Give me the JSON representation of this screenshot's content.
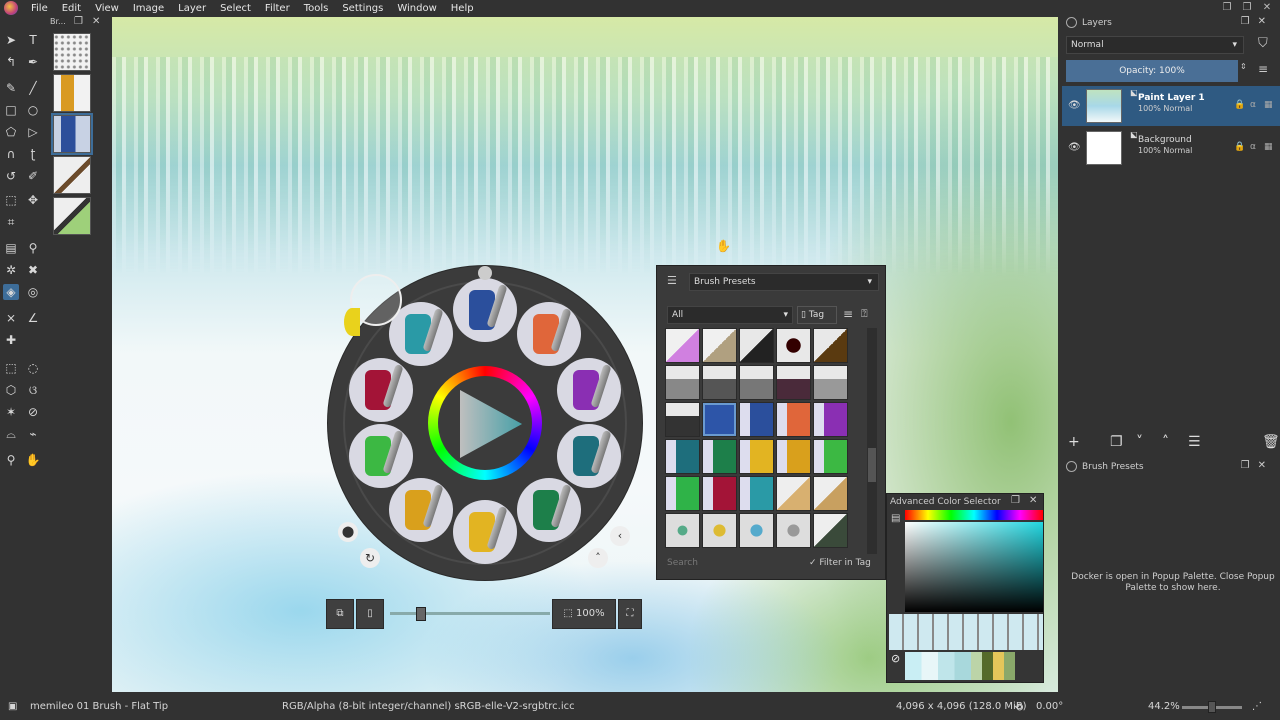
{
  "menu": {
    "items": [
      "File",
      "Edit",
      "View",
      "Image",
      "Layer",
      "Select",
      "Filter",
      "Tools",
      "Settings",
      "Window",
      "Help"
    ]
  },
  "brush_strip": {
    "title": "Br..."
  },
  "layers": {
    "title": "Layers",
    "blend_mode": "Normal",
    "opacity_label": "Opacity:  100%",
    "items": [
      {
        "name": "Paint Layer 1",
        "mode": "100% Normal"
      },
      {
        "name": "Background",
        "mode": "100% Normal"
      }
    ]
  },
  "brush_presets_docker": {
    "title": "Brush Presets",
    "message": "Docker is open in Popup Palette. Close Popup Palette to show here."
  },
  "brush_presets_popup": {
    "title": "Brush Presets",
    "filter": "All",
    "tag_label": "Tag",
    "search_placeholder": "Search",
    "filter_in_tag": "Filter in Tag"
  },
  "color_selector": {
    "title": "Advanced Color Selector"
  },
  "popup_palette": {
    "zoom": "100%"
  },
  "status": {
    "brush": "memileo 01 Brush - Flat Tip",
    "color_space": "RGB/Alpha (8-bit integer/channel)  sRGB-elle-V2-srgbtrc.icc",
    "dimensions": "4,096 x 4,096 (128.0 MiB)",
    "rotation": "0.00°",
    "zoom": "44.2%"
  },
  "colors": {
    "accent": "#3d6d99",
    "panel": "#323232",
    "selected_layer": "#2f5a82"
  }
}
